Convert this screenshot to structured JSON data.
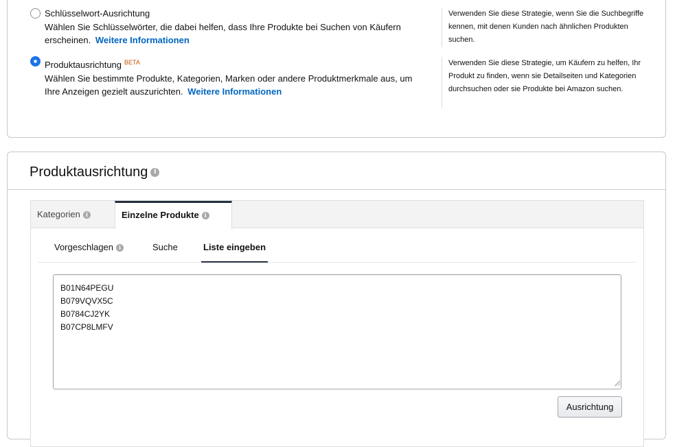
{
  "strategy": {
    "options": [
      {
        "title": "Schlüsselwort-Ausrichtung",
        "description": "Wählen Sie Schlüsselwörter, die dabei helfen, dass Ihre Produkte bei Suchen von Käufern erscheinen.",
        "link": "Weitere Informationen",
        "hint": "Verwenden Sie diese Strategie, wenn Sie die Suchbegriffe kennen, mit denen Kunden nach ähnlichen Produkten suchen.",
        "selected": false
      },
      {
        "title": "Produktausrichtung",
        "badge": "BETA",
        "description": "Wählen Sie bestimmte Produkte, Kategorien, Marken oder andere Produktmerkmale aus, um Ihre Anzeigen gezielt auszurichten.",
        "link": "Weitere Informationen",
        "hint": "Verwenden Sie diese Strategie, um Käufern zu helfen, Ihr Produkt zu finden, wenn sie Detailseiten und Kategorien durchsuchen oder sie Produkte bei Amazon suchen.",
        "selected": true
      }
    ]
  },
  "targeting": {
    "title": "Produktausrichtung",
    "tabs": [
      {
        "label": "Kategorien",
        "active": false
      },
      {
        "label": "Einzelne Produkte",
        "active": true
      }
    ],
    "subtabs": [
      {
        "label": "Vorgeschlagen",
        "active": false
      },
      {
        "label": "Suche",
        "active": false
      },
      {
        "label": "Liste eingeben",
        "active": true
      }
    ],
    "asin_list": "B01N64PEGU\nB079VQVX5C\nB0784CJ2YK\nB07CP8LMFV",
    "button_label": "Ausrichtung"
  },
  "icons": {
    "info": "info-icon",
    "radio_selected": "radio-checked-icon",
    "radio_unselected": "radio-unchecked-icon"
  },
  "colors": {
    "link": "#0066c0",
    "radio_accent": "#1a73e8",
    "beta_badge": "#c45500",
    "active_tab_border": "#232f3e"
  }
}
